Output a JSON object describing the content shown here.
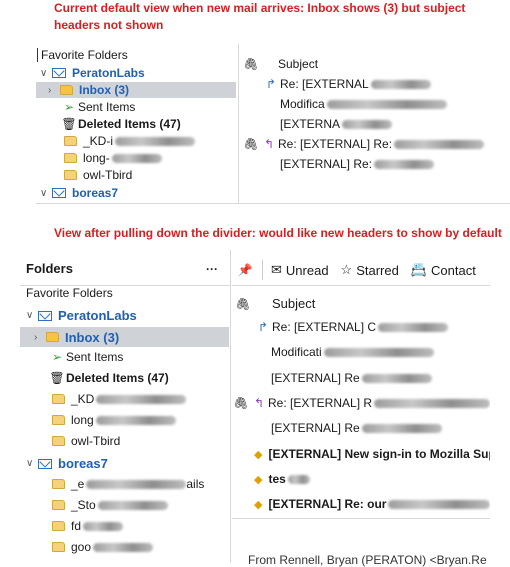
{
  "captions": {
    "top": "Current default view when new mail arrives: Inbox shows (3) but subject headers not shown",
    "bottom": "View after pulling down the divider: would like new headers to show by default"
  },
  "top": {
    "favorite_folders": "Favorite Folders",
    "account1": "PeratonLabs",
    "inbox": "Inbox (3)",
    "sent": "Sent Items",
    "deleted": "Deleted Items (47)",
    "kd": "_KD-i",
    "long": "long-",
    "owl": "owl-Tbird",
    "account2": "boreas7",
    "subject_header": "Subject",
    "messages": [
      "Re: [EXTERNAL",
      "Modifica",
      "[EXTERNA",
      "Re: [EXTERNAL] Re:",
      "[EXTERNAL] Re: "
    ]
  },
  "bottom": {
    "folders_title": "Folders",
    "menu_dots": "···",
    "toolbar": {
      "unread": "Unread",
      "starred": "Starred",
      "contact": "Contact"
    },
    "favorite_folders": "Favorite Folders",
    "account1": "PeratonLabs",
    "inbox": "Inbox (3)",
    "sent": "Sent Items",
    "deleted": "Deleted Items (47)",
    "kd": "_KD",
    "long": "long",
    "owl": "owl-Tbird",
    "account2": "boreas7",
    "b7_folders": [
      "_e",
      "_Sto",
      "fd",
      "goo"
    ],
    "b7_suffix": "ails",
    "subject_header": "Subject",
    "messages": [
      "Re: [EXTERNAL] C",
      "Modificati",
      "[EXTERNAL] Re",
      "Re: [EXTERNAL] R",
      "[EXTERNAL] Re",
      "[EXTERNAL] New sign-in to Mozilla Sup",
      "tes",
      "[EXTERNAL] Re: our"
    ],
    "from_line": "From  Rennell, Bryan (PERATON) <Bryan.Re"
  }
}
